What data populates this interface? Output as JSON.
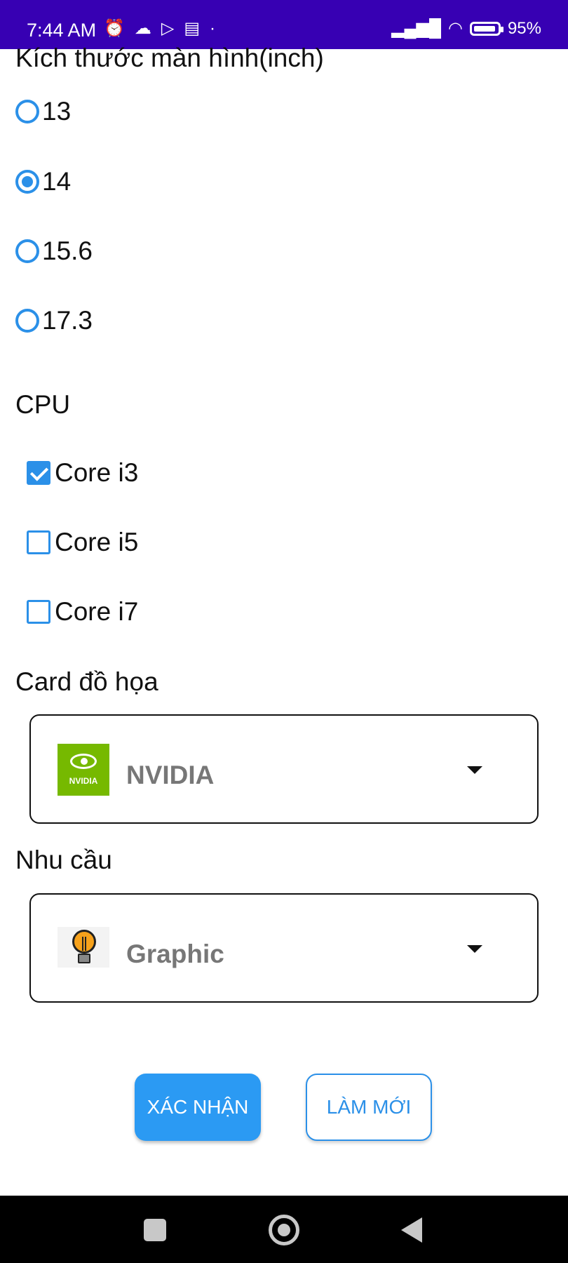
{
  "status_bar": {
    "time": "7:44 AM",
    "battery": "95%",
    "battery_level": 0.95,
    "icons": [
      "alarm-icon",
      "cloud-icon",
      "play-icon",
      "sim-icon",
      "dot-icon",
      "signal-icon",
      "wifi-icon",
      "battery-icon"
    ]
  },
  "form": {
    "screen_size": {
      "title": "Kích thước màn hình(inch)",
      "options": [
        "13",
        "14",
        "15.6",
        "17.3"
      ],
      "selected": "14"
    },
    "cpu": {
      "title": "CPU",
      "options": [
        {
          "label": "Core i3",
          "checked": true
        },
        {
          "label": "Core i5",
          "checked": false
        },
        {
          "label": "Core i7",
          "checked": false
        }
      ]
    },
    "graphics_card": {
      "title": "Card đồ họa",
      "selected_label": "NVIDIA",
      "logo_text": "NVIDIA",
      "logo_color": "#76b900"
    },
    "needs": {
      "title": "Nhu cầu",
      "selected_label": "Graphic",
      "icon": "lightbulb-icon"
    }
  },
  "buttons": {
    "confirm_label": "XÁC NHẬN",
    "reset_label": "LÀM MỚI"
  },
  "colors": {
    "status_bar": "#3700b3",
    "accent": "#2b90e8",
    "primary_button": "#2b9af3"
  }
}
